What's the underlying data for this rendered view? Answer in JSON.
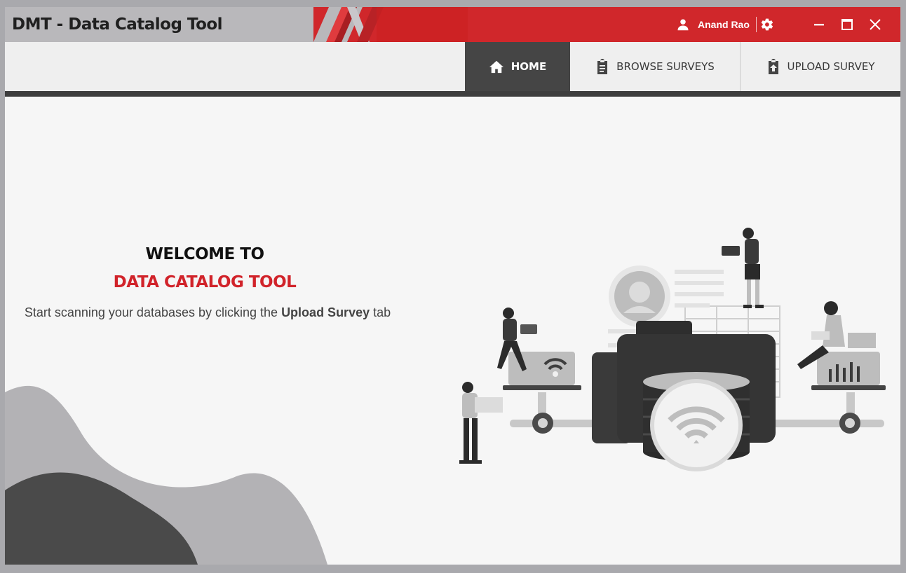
{
  "window": {
    "title": "DMT - Data Catalog Tool"
  },
  "user": {
    "name": "Anand Rao",
    "icon": "user-icon",
    "settings_icon": "gear-icon"
  },
  "window_controls": {
    "minimize_icon": "minimize-icon",
    "maximize_icon": "maximize-icon",
    "close_icon": "close-icon"
  },
  "tabs": [
    {
      "label": "HOME",
      "icon": "home-icon",
      "active": true
    },
    {
      "label": "BROWSE SURVEYS",
      "icon": "clipboard-icon",
      "active": false
    },
    {
      "label": "UPLOAD SURVEY",
      "icon": "upload-icon",
      "active": false
    }
  ],
  "welcome": {
    "line1": "WELCOME TO",
    "line2": "DATA CATALOG TOOL",
    "desc_pre": "Start scanning your databases by clicking the ",
    "desc_bold": "Upload Survey",
    "desc_post": " tab"
  },
  "colors": {
    "accent": "#d1232a",
    "dark": "#454545",
    "title_bg": "#b9b8bb",
    "nav_bg": "#efefef"
  }
}
